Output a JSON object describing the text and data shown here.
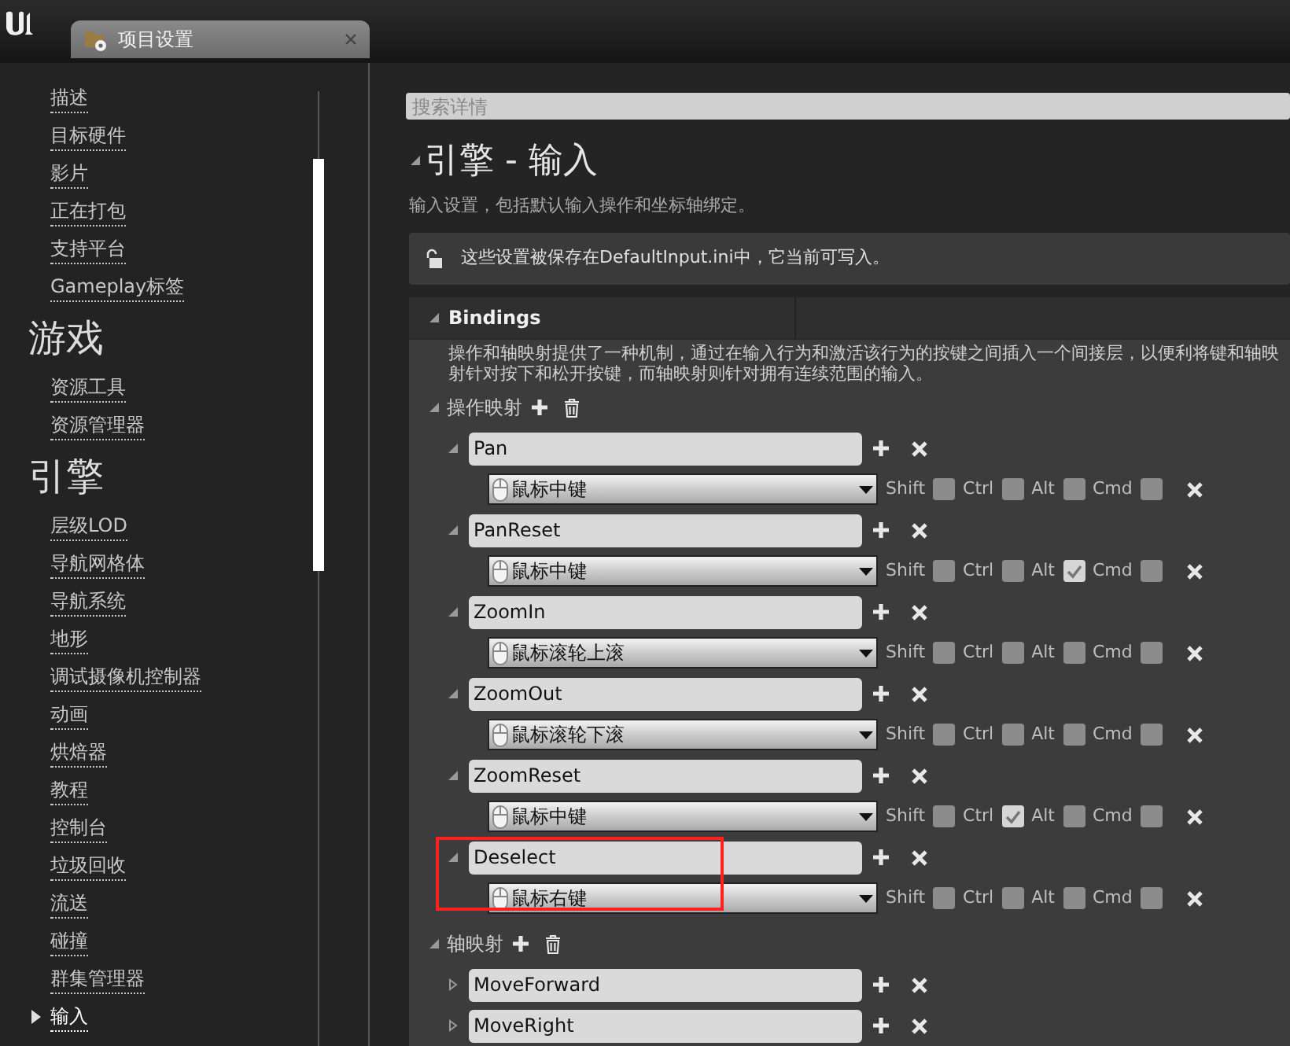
{
  "window": {
    "tab_title": "项目设置"
  },
  "sidebar": {
    "sections": [
      {
        "items": [
          {
            "label": "描述",
            "selected": false
          },
          {
            "label": "目标硬件",
            "selected": false
          },
          {
            "label": "影片",
            "selected": false
          },
          {
            "label": "正在打包",
            "selected": false
          },
          {
            "label": "支持平台",
            "selected": false
          },
          {
            "label": "Gameplay标签",
            "selected": false
          }
        ]
      },
      {
        "title": "游戏",
        "items": [
          {
            "label": "资源工具",
            "selected": false
          },
          {
            "label": "资源管理器",
            "selected": false
          }
        ]
      },
      {
        "title": "引擎",
        "items": [
          {
            "label": "层级LOD",
            "selected": false
          },
          {
            "label": "导航网格体",
            "selected": false
          },
          {
            "label": "导航系统",
            "selected": false
          },
          {
            "label": "地形",
            "selected": false
          },
          {
            "label": "调试摄像机控制器",
            "selected": false
          },
          {
            "label": "动画",
            "selected": false
          },
          {
            "label": "烘焙器",
            "selected": false
          },
          {
            "label": "教程",
            "selected": false
          },
          {
            "label": "控制台",
            "selected": false
          },
          {
            "label": "垃圾回收",
            "selected": false
          },
          {
            "label": "流送",
            "selected": false
          },
          {
            "label": "碰撞",
            "selected": false
          },
          {
            "label": "群集管理器",
            "selected": false
          },
          {
            "label": "输入",
            "selected": true
          }
        ]
      }
    ]
  },
  "search": {
    "placeholder": "搜索详情"
  },
  "page": {
    "title": "引擎 - 输入",
    "subtitle": "输入设置，包括默认输入操作和坐标轴绑定。",
    "notice": "这些设置被保存在DefaultInput.ini中，它当前可写入。"
  },
  "bindings": {
    "title": "Bindings",
    "expanded": true,
    "description": [
      "操作和轴映射提供了一种机制，通过在输入行为和激活该行为的按键之间插入一个间接层，以便利将键和轴映",
      "射针对按下和松开按键，而轴映射则针对拥有连续范围的输入。"
    ],
    "action_mappings": {
      "label": "操作映射",
      "expanded": true,
      "items": [
        {
          "name": "Pan",
          "expanded": true,
          "highlighted": false,
          "keys": [
            {
              "key": "鼠标中键",
              "modifiers": [
                {
                  "label": "Shift",
                  "checked": false
                },
                {
                  "label": "Ctrl",
                  "checked": false
                },
                {
                  "label": "Alt",
                  "checked": false
                },
                {
                  "label": "Cmd",
                  "checked": false
                }
              ]
            }
          ]
        },
        {
          "name": "PanReset",
          "expanded": true,
          "highlighted": false,
          "keys": [
            {
              "key": "鼠标中键",
              "modifiers": [
                {
                  "label": "Shift",
                  "checked": false
                },
                {
                  "label": "Ctrl",
                  "checked": false
                },
                {
                  "label": "Alt",
                  "checked": true
                },
                {
                  "label": "Cmd",
                  "checked": false
                }
              ]
            }
          ]
        },
        {
          "name": "ZoomIn",
          "expanded": true,
          "highlighted": false,
          "keys": [
            {
              "key": "鼠标滚轮上滚",
              "modifiers": [
                {
                  "label": "Shift",
                  "checked": false
                },
                {
                  "label": "Ctrl",
                  "checked": false
                },
                {
                  "label": "Alt",
                  "checked": false
                },
                {
                  "label": "Cmd",
                  "checked": false
                }
              ]
            }
          ]
        },
        {
          "name": "ZoomOut",
          "expanded": true,
          "highlighted": false,
          "keys": [
            {
              "key": "鼠标滚轮下滚",
              "modifiers": [
                {
                  "label": "Shift",
                  "checked": false
                },
                {
                  "label": "Ctrl",
                  "checked": false
                },
                {
                  "label": "Alt",
                  "checked": false
                },
                {
                  "label": "Cmd",
                  "checked": false
                }
              ]
            }
          ]
        },
        {
          "name": "ZoomReset",
          "expanded": true,
          "highlighted": false,
          "keys": [
            {
              "key": "鼠标中键",
              "modifiers": [
                {
                  "label": "Shift",
                  "checked": false
                },
                {
                  "label": "Ctrl",
                  "checked": true
                },
                {
                  "label": "Alt",
                  "checked": false
                },
                {
                  "label": "Cmd",
                  "checked": false
                }
              ]
            }
          ]
        },
        {
          "name": "Deselect",
          "expanded": true,
          "highlighted": true,
          "keys": [
            {
              "key": "鼠标右键",
              "modifiers": [
                {
                  "label": "Shift",
                  "checked": false
                },
                {
                  "label": "Ctrl",
                  "checked": false
                },
                {
                  "label": "Alt",
                  "checked": false
                },
                {
                  "label": "Cmd",
                  "checked": false
                }
              ]
            }
          ]
        }
      ]
    },
    "axis_mappings": {
      "label": "轴映射",
      "expanded": true,
      "items": [
        {
          "name": "MoveForward",
          "expanded": false,
          "highlighted": false
        },
        {
          "name": "MoveRight",
          "expanded": false,
          "highlighted": false
        }
      ]
    }
  }
}
